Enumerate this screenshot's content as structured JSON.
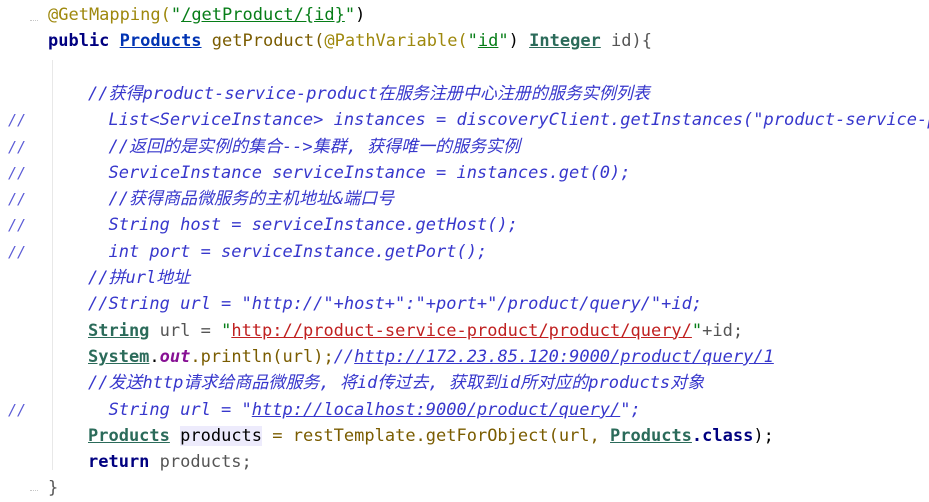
{
  "editor": {
    "lines": [
      {
        "gutter": "",
        "segments": [
          {
            "t": "@GetMapping(",
            "c": "ann"
          },
          {
            "t": "\"",
            "c": "str"
          },
          {
            "t": "/getProduct/{id}",
            "c": "strd"
          },
          {
            "t": "\"",
            "c": "str"
          },
          {
            "t": ")",
            "c": "plain"
          }
        ]
      },
      {
        "gutter": "",
        "segments": [
          {
            "t": "public ",
            "c": "kw"
          },
          {
            "t": "Products",
            "c": "typec"
          },
          {
            "t": " getProduct(",
            "c": "method"
          },
          {
            "t": "@PathVariable(",
            "c": "ann"
          },
          {
            "t": "\"",
            "c": "str"
          },
          {
            "t": "id",
            "c": "strd"
          },
          {
            "t": "\"",
            "c": "str"
          },
          {
            "t": ") ",
            "c": "plain"
          },
          {
            "t": "Integer",
            "c": "type"
          },
          {
            "t": " id){",
            "c": "dim"
          }
        ]
      },
      {
        "gutter": "",
        "segments": []
      },
      {
        "gutter": "",
        "segments": [
          {
            "t": "//获得product-service-product在服务注册中心注册的服务实例列表",
            "c": "cmt"
          }
        ]
      },
      {
        "gutter": "//",
        "segments": [
          {
            "t": "  List<ServiceInstance> instances = discoveryClient.getInstances(\"product-service-pr",
            "c": "cmt"
          }
        ]
      },
      {
        "gutter": "//",
        "segments": [
          {
            "t": "  //返回的是实例的集合-->集群, 获得唯一的服务实例",
            "c": "cmt"
          }
        ]
      },
      {
        "gutter": "//",
        "segments": [
          {
            "t": "  ServiceInstance serviceInstance = instances.get(0);",
            "c": "cmt"
          }
        ]
      },
      {
        "gutter": "//",
        "segments": [
          {
            "t": "  //获得商品微服务的主机地址&端口号",
            "c": "cmt"
          }
        ]
      },
      {
        "gutter": "//",
        "segments": [
          {
            "t": "  String host = serviceInstance.getHost();",
            "c": "cmt"
          }
        ]
      },
      {
        "gutter": "//",
        "segments": [
          {
            "t": "  int port = serviceInstance.getPort();",
            "c": "cmt"
          }
        ]
      },
      {
        "gutter": "",
        "segments": [
          {
            "t": "//拼url地址",
            "c": "cmt"
          }
        ]
      },
      {
        "gutter": "",
        "segments": [
          {
            "t": "//String url = \"http://\"+host+\":\"+port+\"/product/query/\"+id;",
            "c": "cmt"
          }
        ]
      },
      {
        "gutter": "",
        "segments": [
          {
            "t": "String",
            "c": "type"
          },
          {
            "t": " url = ",
            "c": "dim"
          },
          {
            "t": "\"",
            "c": "str"
          },
          {
            "t": "http://product-service-product/product/query/",
            "c": "urlstr"
          },
          {
            "t": "\"",
            "c": "str"
          },
          {
            "t": "+id;",
            "c": "dim"
          }
        ]
      },
      {
        "gutter": "",
        "segments": [
          {
            "t": "System",
            "c": "type"
          },
          {
            "t": ".",
            "c": "plain"
          },
          {
            "t": "out",
            "c": "fld"
          },
          {
            "t": ".println(url);",
            "c": "method"
          },
          {
            "t": "//",
            "c": "cmt"
          },
          {
            "t": "http://172.23.85.120:9000/product/query/1",
            "c": "cmtlink"
          }
        ]
      },
      {
        "gutter": "",
        "segments": [
          {
            "t": "//发送http请求给商品微服务, 将id传过去, 获取到id所对应的products对象",
            "c": "cmt"
          }
        ]
      },
      {
        "gutter": "//",
        "segments": [
          {
            "t": "  String url = \"",
            "c": "cmt"
          },
          {
            "t": "http://localhost:9000/product/query/",
            "c": "cmtlink"
          },
          {
            "t": "\";",
            "c": "cmt"
          }
        ]
      },
      {
        "gutter": "",
        "segments": [
          {
            "t": "Products",
            "c": "type"
          },
          {
            "t": " ",
            "c": "plain"
          },
          {
            "t": "products",
            "c": "hl"
          },
          {
            "t": " = restTemplate.getForObject(url, ",
            "c": "method"
          },
          {
            "t": "Products",
            "c": "type"
          },
          {
            "t": ".class",
            "c": "kw"
          },
          {
            "t": ");",
            "c": "plain"
          }
        ]
      },
      {
        "gutter": "",
        "segments": [
          {
            "t": "return ",
            "c": "kw"
          },
          {
            "t": "products;",
            "c": "dim"
          }
        ]
      },
      {
        "gutter": "",
        "segments": [
          {
            "t": "}",
            "c": "dim"
          }
        ]
      }
    ]
  }
}
